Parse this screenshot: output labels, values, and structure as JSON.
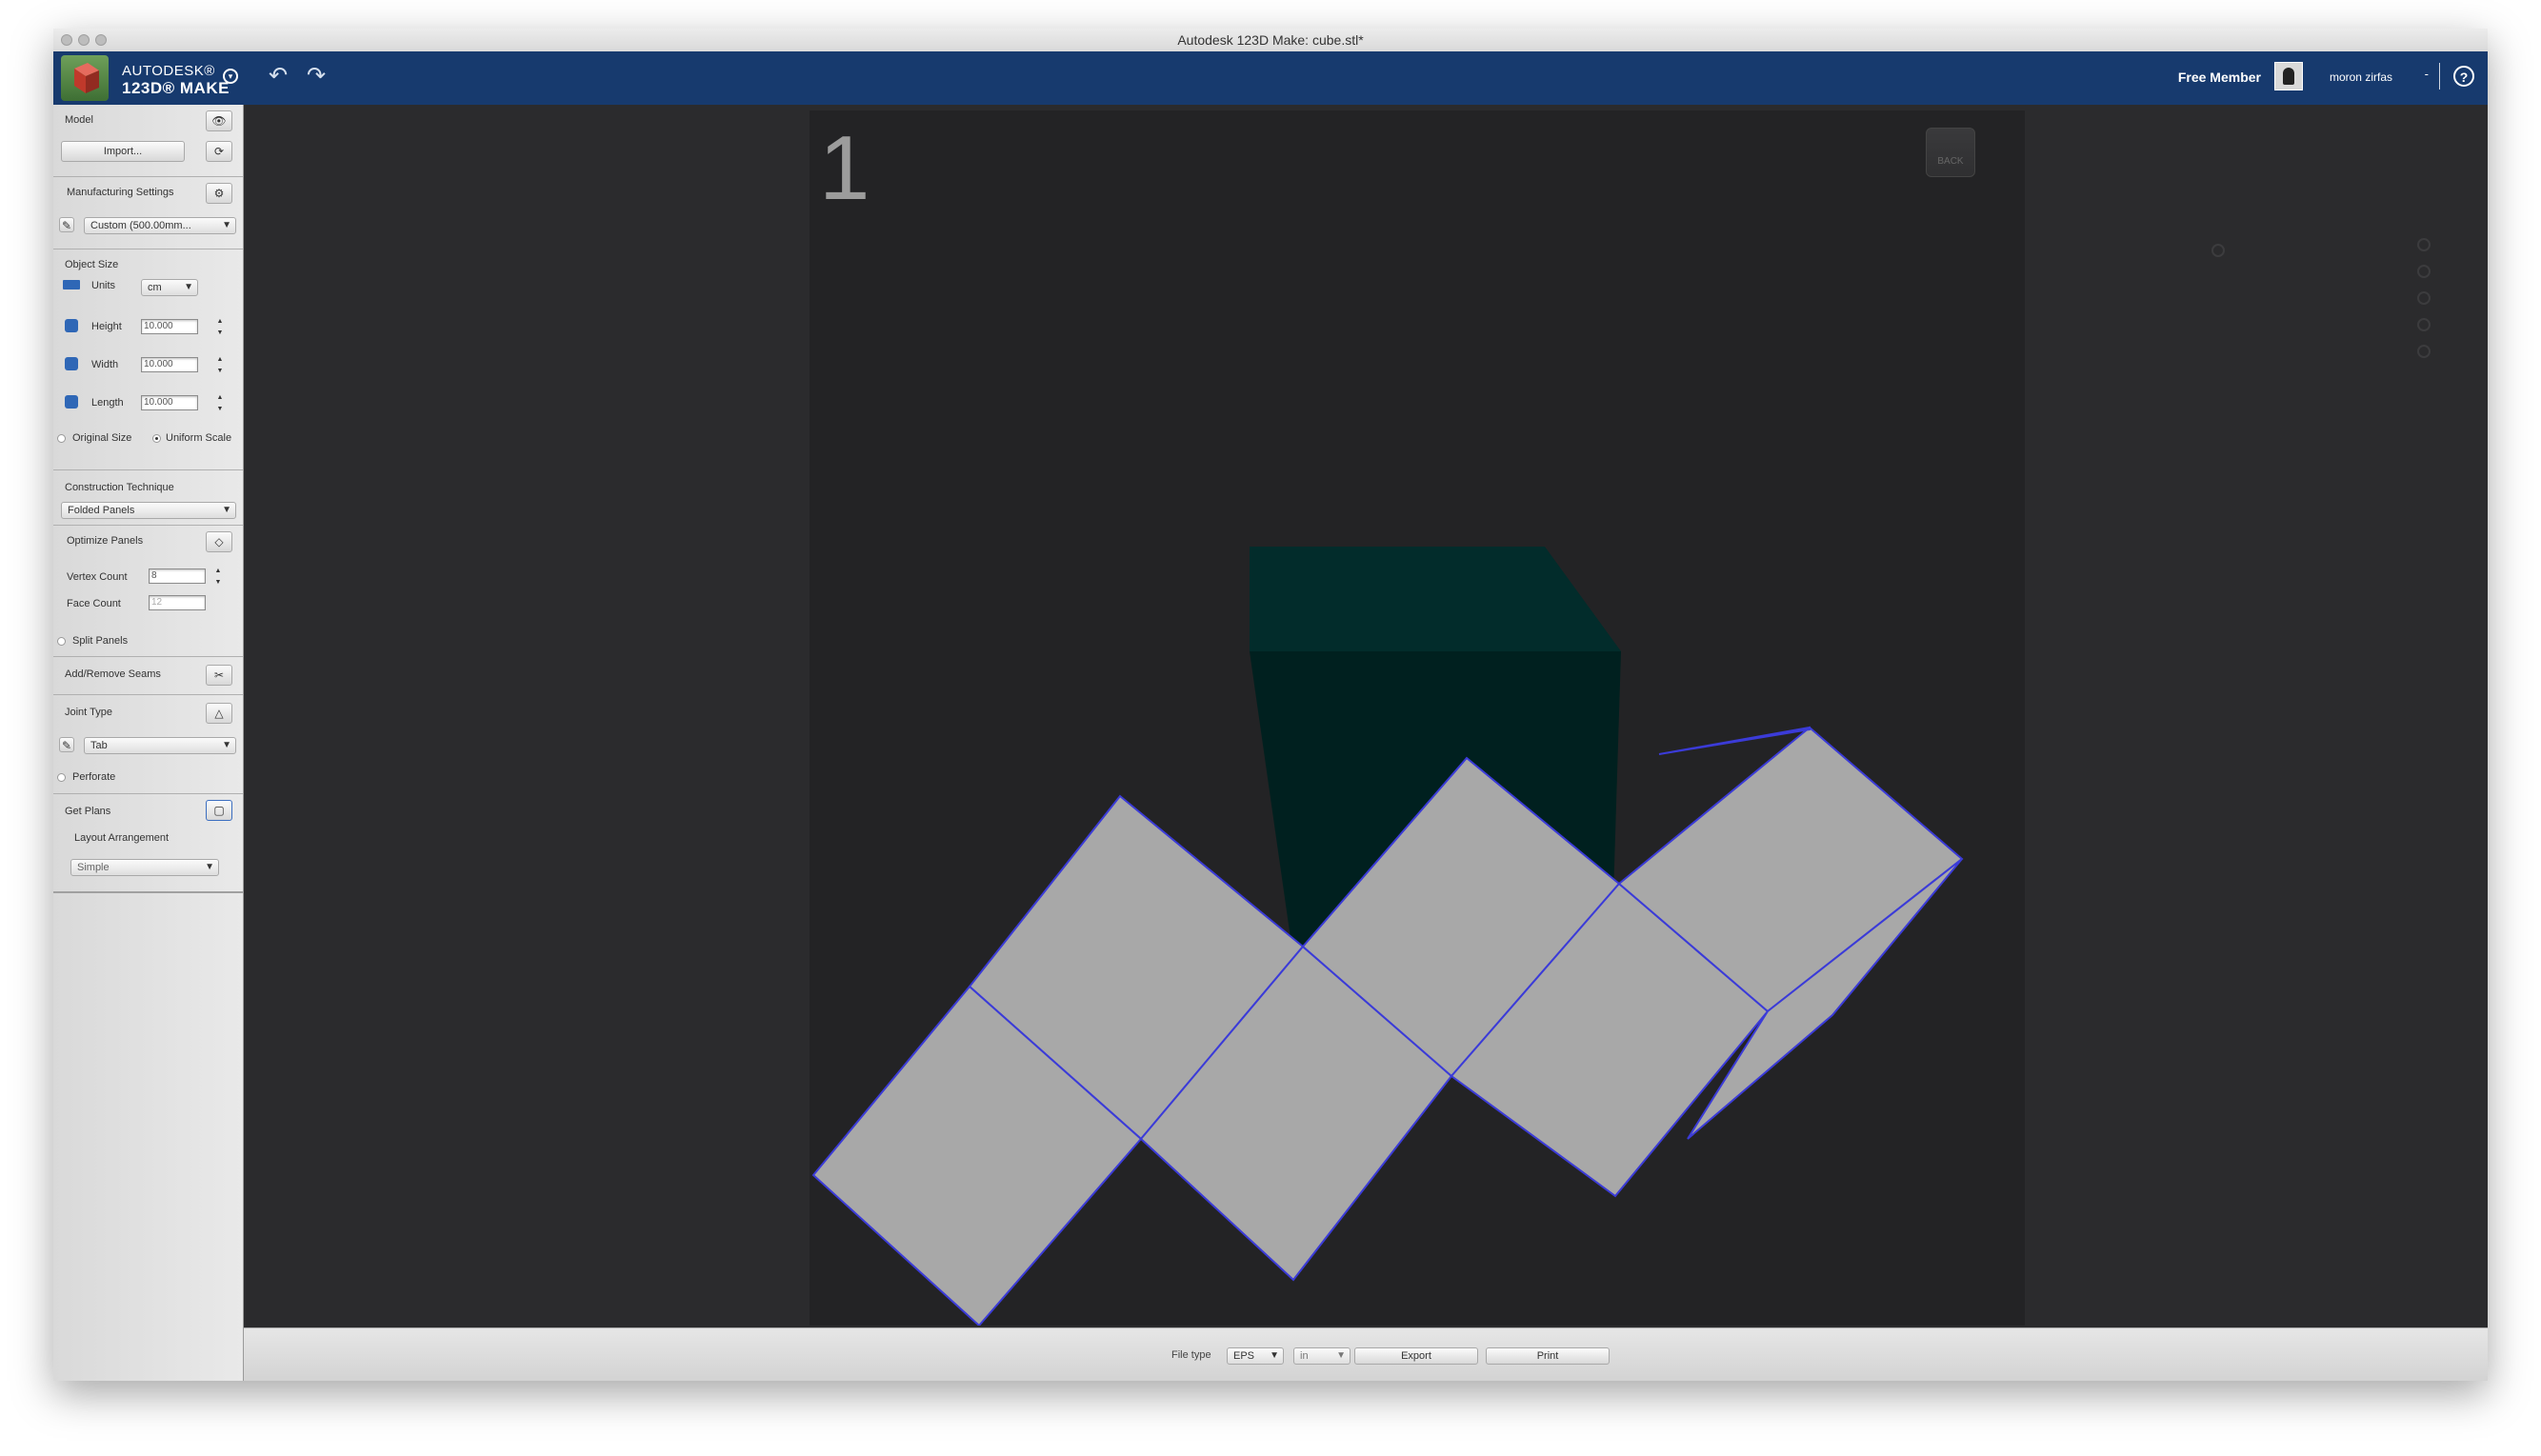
{
  "window": {
    "title": "Autodesk 123D Make: cube.stl*"
  },
  "brand": {
    "line1": "AUTODESK®",
    "line2": "123D® MAKE"
  },
  "account": {
    "membership": "Free Member",
    "username": "moron zirfas",
    "caret": "-",
    "help": "?"
  },
  "sidebar": {
    "model": {
      "title": "Model",
      "import_label": "Import..."
    },
    "manufacturing": {
      "title": "Manufacturing Settings",
      "preset": "Custom (500.00mm..."
    },
    "object_size": {
      "title": "Object Size",
      "units_label": "Units",
      "units_value": "cm",
      "height_label": "Height",
      "height_value": "10.000",
      "width_label": "Width",
      "width_value": "10.000",
      "length_label": "Length",
      "length_value": "10.000",
      "original_size_label": "Original Size",
      "uniform_scale_label": "Uniform Scale"
    },
    "construction": {
      "title": "Construction Technique",
      "value": "Folded Panels"
    },
    "optimize": {
      "title": "Optimize Panels",
      "vertex_label": "Vertex Count",
      "vertex_value": "8",
      "face_label": "Face Count",
      "face_value": "12",
      "split_label": "Split Panels"
    },
    "seams": {
      "title": "Add/Remove Seams"
    },
    "joint": {
      "title": "Joint Type",
      "value": "Tab",
      "perforate_label": "Perforate"
    },
    "plans": {
      "title": "Get Plans",
      "layout_label": "Layout Arrangement",
      "layout_value": "Simple"
    }
  },
  "viewport": {
    "page_number": "1",
    "view_cube_label": "BACK"
  },
  "footer": {
    "file_type_label": "File type",
    "file_type": "EPS",
    "unit": "in",
    "export_label": "Export",
    "print_label": "Print"
  },
  "colors": {
    "appbar": "#173a6e",
    "panel": "#a8a8a8",
    "panel_outline": "#3b3bd8",
    "hole": "#e02020",
    "cube_front": "#00201f",
    "cube_top": "#022c2b"
  }
}
